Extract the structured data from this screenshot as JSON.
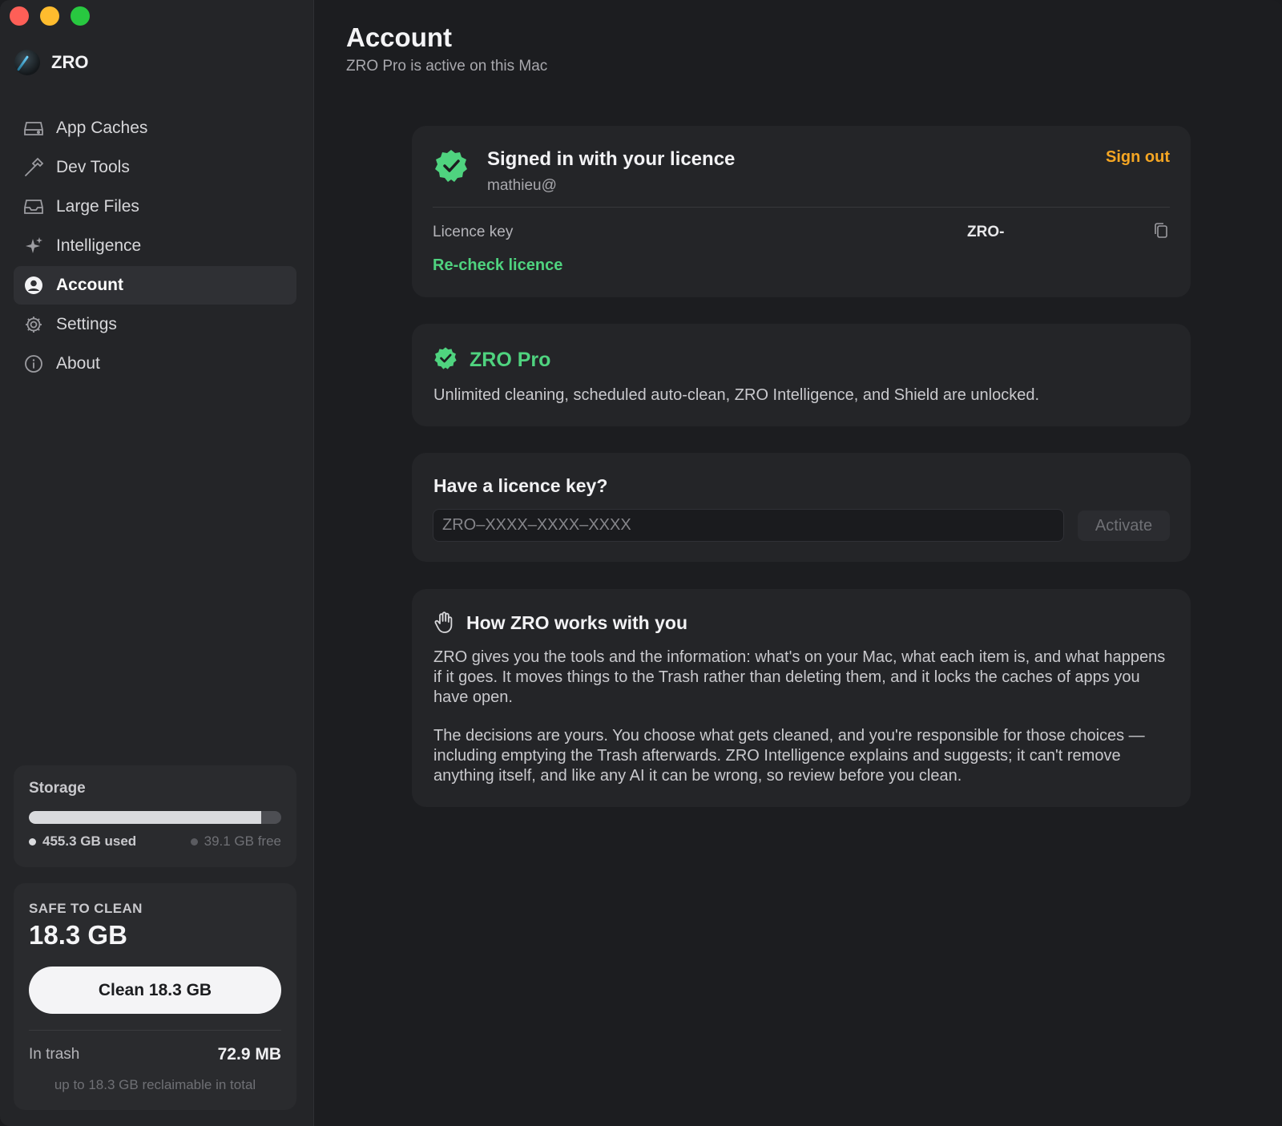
{
  "sidebar": {
    "brand": "ZRO",
    "items": [
      {
        "label": "App Caches",
        "icon": "drive-icon"
      },
      {
        "label": "Dev Tools",
        "icon": "hammer-icon"
      },
      {
        "label": "Large Files",
        "icon": "tray-icon"
      },
      {
        "label": "Intelligence",
        "icon": "sparkles-icon"
      },
      {
        "label": "Account",
        "icon": "person-circle-icon",
        "active": true
      },
      {
        "label": "Settings",
        "icon": "gear-icon"
      },
      {
        "label": "About",
        "icon": "info-icon"
      }
    ],
    "storage": {
      "title": "Storage",
      "used_fraction": 0.921,
      "used_label": "455.3 GB used",
      "free_label": "39.1 GB free"
    },
    "clean": {
      "label": "SAFE TO CLEAN",
      "value": "18.3 GB",
      "button": "Clean 18.3 GB",
      "trash_label": "In trash",
      "trash_value": "72.9 MB",
      "note": "up to 18.3 GB reclaimable in total"
    }
  },
  "main": {
    "title": "Account",
    "subtitle": "ZRO Pro is active on this Mac",
    "signed": {
      "title": "Signed in with your licence",
      "email": "mathieu@",
      "sign_out": "Sign out",
      "key_label": "Licence key",
      "key_value": "ZRO-",
      "recheck": "Re-check licence"
    },
    "pro": {
      "title": "ZRO Pro",
      "description": "Unlimited cleaning, scheduled auto-clean, ZRO Intelligence, and Shield are unlocked."
    },
    "licence_entry": {
      "title": "Have a licence key?",
      "placeholder": "ZRO–XXXX–XXXX–XXXX",
      "button": "Activate"
    },
    "how": {
      "title": "How ZRO works with you",
      "p1": "ZRO gives you the tools and the information: what's on your Mac, what each item is, and what happens if it goes. It moves things to the Trash rather than deleting them, and it locks the caches of apps you have open.",
      "p2": "The decisions are yours. You choose what gets cleaned, and you're responsible for those choices — including emptying the Trash afterwards. ZRO Intelligence explains and suggests; it can't remove anything itself, and like any AI it can be wrong, so review before you clean."
    }
  },
  "colors": {
    "accent_green": "#4fd37f",
    "sign_out_orange": "#f5a623",
    "used_dot": "#d9dadd",
    "free_dot": "#5a5b60"
  }
}
